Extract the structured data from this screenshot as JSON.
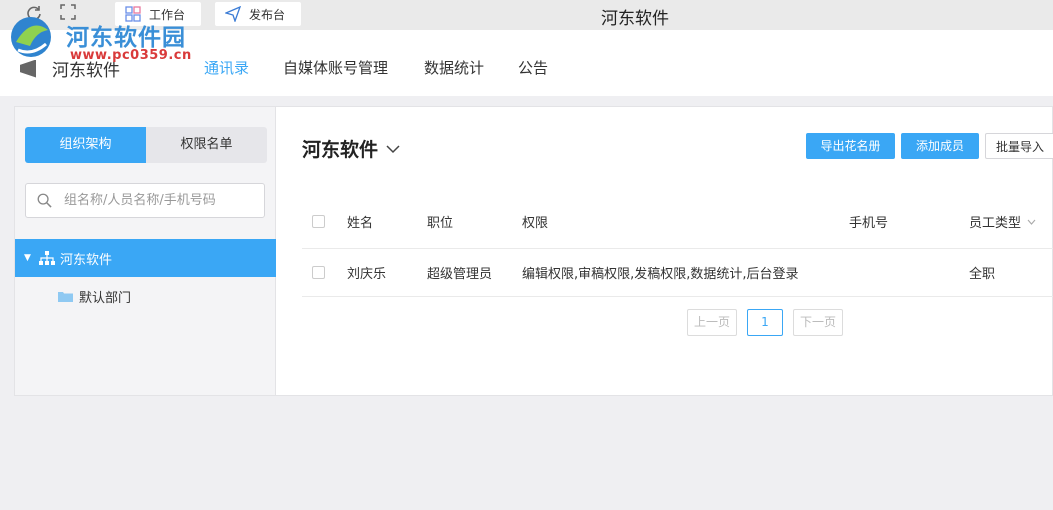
{
  "titlebar": {
    "tabs": [
      {
        "label": "工作台",
        "icon": "grid-icon"
      },
      {
        "label": "发布台",
        "icon": "send-icon"
      }
    ],
    "app_title": "河东软件",
    "icons": [
      "refresh-icon",
      "fullscreen-icon"
    ]
  },
  "watermark": {
    "text": "河东软件园",
    "url_text": "www.pc0359.cn"
  },
  "nav": {
    "brand": "河东软件",
    "items": [
      "通讯录",
      "自媒体账号管理",
      "数据统计",
      "公告"
    ],
    "active_index": 0
  },
  "sidebar": {
    "tabs": [
      "组织架构",
      "权限名单"
    ],
    "active_tab": 0,
    "search_placeholder": "组名称/人员名称/手机号码",
    "tree_root": "河东软件",
    "tree_children": [
      "默认部门"
    ]
  },
  "main": {
    "title": "河东软件",
    "buttons": [
      "导出花名册",
      "添加成员",
      "批量导入"
    ],
    "columns": [
      "姓名",
      "职位",
      "权限",
      "手机号",
      "员工类型"
    ],
    "rows": [
      {
        "name": "刘庆乐",
        "position": "超级管理员",
        "permissions": "编辑权限,审稿权限,发稿权限,数据统计,后台登录",
        "phone": "",
        "type": "全职"
      }
    ],
    "pagination": {
      "prev": "上一页",
      "current": "1",
      "next": "下一页"
    }
  },
  "colors": {
    "accent": "#3aa7f5",
    "watermark_blue": "#3a8fd7",
    "watermark_red": "#d93a3a"
  }
}
